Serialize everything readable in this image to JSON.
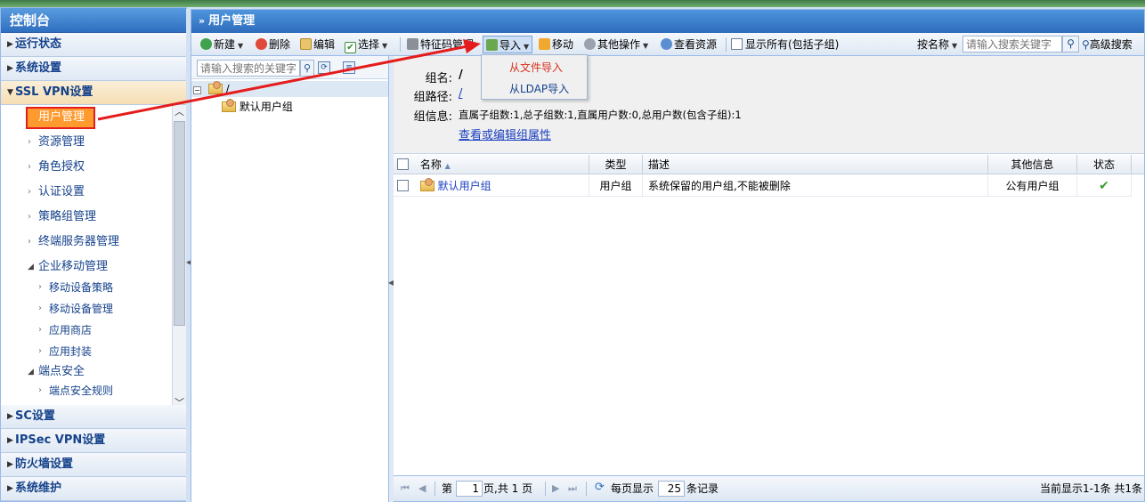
{
  "sidebar": {
    "title": "控制台",
    "groups_top": [
      "运行状态",
      "系统设置"
    ],
    "open_group": "SSL VPN设置",
    "items": [
      "用户管理",
      "资源管理",
      "角色授权",
      "认证设置",
      "策略组管理",
      "终端服务器管理"
    ],
    "enterprise": {
      "label": "企业移动管理",
      "children": [
        "移动设备策略",
        "移动设备管理",
        "应用商店",
        "应用封装"
      ]
    },
    "endpoint": {
      "label": "端点安全",
      "children": [
        "端点安全规则"
      ]
    },
    "groups_bottom": [
      "SC设置",
      "IPSec VPN设置",
      "防火墙设置",
      "系统维护"
    ]
  },
  "main": {
    "title": "用户管理",
    "toolbar": {
      "new": "新建",
      "delete": "删除",
      "edit": "编辑",
      "select": "选择",
      "cert": "特征码管理",
      "import": "导入",
      "move": "移动",
      "other": "其他操作",
      "view": "查看资源",
      "show_all": "显示所有(包括子组)",
      "sort": "按名称",
      "search_placeholder": "请输入搜索关键字",
      "advanced": "高级搜索"
    },
    "import_menu": [
      "从文件导入",
      "从LDAP导入"
    ],
    "tree": {
      "search_placeholder": "请输入搜索的关键字",
      "root": "/",
      "child": "默认用户组"
    },
    "detail": {
      "name_label": "组名:",
      "name_value": "/",
      "path_label": "组路径:",
      "path_value": "/",
      "info_label": "组信息:",
      "info_value": "直属子组数:1,总子组数:1,直属用户数:0,总用户数(包含子组):1",
      "edit_link": "查看或编辑组属性"
    },
    "grid": {
      "headers": [
        "名称",
        "类型",
        "描述",
        "其他信息",
        "状态"
      ],
      "rows": [
        {
          "name": "默认用户组",
          "type": "用户组",
          "desc": "系统保留的用户组,不能被删除",
          "other": "公有用户组",
          "status": "✔"
        }
      ]
    },
    "pager": {
      "page_prefix": "第",
      "page": "1",
      "page_suffix": "页,共 1 页",
      "per_page_label": "每页显示",
      "per_page": "25",
      "per_page_suffix": "条记录",
      "summary": "当前显示1-1条 共1条"
    }
  },
  "colors": {
    "highlight": "#ff9a2e",
    "annotation": "#e51c1c",
    "title_blue": "#2e6cbc"
  }
}
